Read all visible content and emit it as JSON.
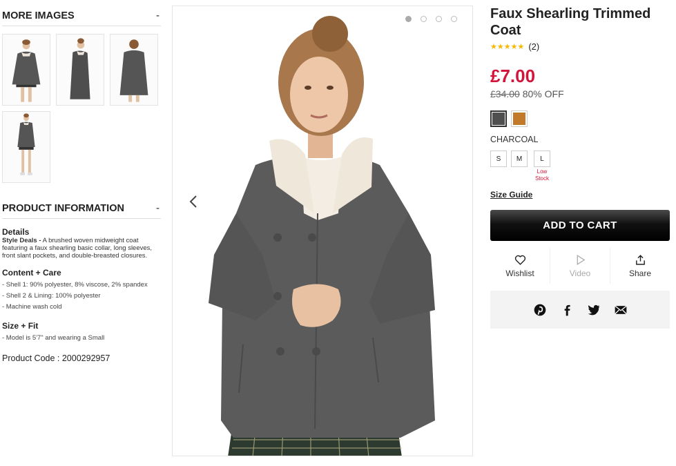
{
  "more_images": {
    "heading": "MORE IMAGES",
    "toggle": "-",
    "thumbs": [
      {
        "icon": "model-front-thumb"
      },
      {
        "icon": "model-side-thumb"
      },
      {
        "icon": "model-back-thumb"
      },
      {
        "icon": "model-full-thumb"
      }
    ]
  },
  "product_info": {
    "heading": "PRODUCT INFORMATION",
    "toggle": "-",
    "details_title": "Details",
    "details_brand": "Style Deals -",
    "details_text": " A brushed woven midweight coat featuring a faux shearling basic collar, long sleeves, front slant pockets, and double-breasted closures.",
    "care_title": "Content + Care",
    "care_items": [
      "- Shell 1: 90% polyester, 8% viscose, 2% spandex",
      "- Shell 2 & Lining: 100% polyester",
      "- Machine wash cold"
    ],
    "fit_title": "Size + Fit",
    "fit_items": [
      "- Model is 5'7\" and wearing a Small"
    ],
    "product_code": "Product Code : 2000292957"
  },
  "viewer": {
    "dots": 4,
    "active_dot": 0,
    "prev": "‹",
    "next": "›"
  },
  "product": {
    "title": "Faux Shearling Trimmed Coat",
    "stars": "★★★★★",
    "review_count": "(2)",
    "price": "£7.00",
    "was_price": "£34.00",
    "discount": "80% OFF",
    "colors": [
      {
        "name": "charcoal",
        "hex": "#4f4f4f",
        "selected": true
      },
      {
        "name": "camel",
        "hex": "#c27a2a",
        "selected": false
      }
    ],
    "selected_color": "CHARCOAL",
    "sizes": [
      {
        "label": "S",
        "note": ""
      },
      {
        "label": "M",
        "note": ""
      },
      {
        "label": "L",
        "note": "Low Stock"
      }
    ],
    "size_guide": "Size Guide",
    "add_to_cart": "ADD TO CART",
    "actions": {
      "wishlist": "Wishlist",
      "video": "Video",
      "share": "Share"
    },
    "accent_color": "#d2153b"
  }
}
